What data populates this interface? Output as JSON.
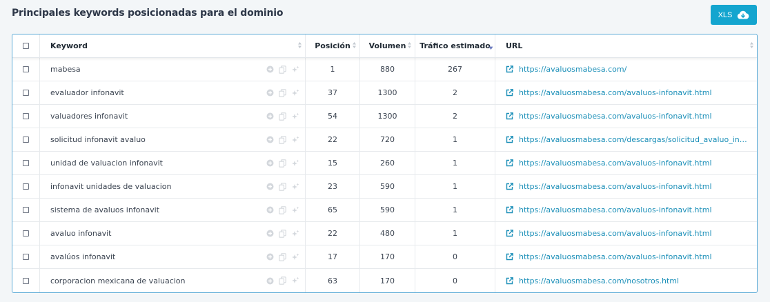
{
  "page_title": "Principales keywords posicionadas para el dominio",
  "export_button": {
    "label": "XLS",
    "icon": "cloud-download-icon"
  },
  "colors": {
    "accent": "#14a5cf",
    "link": "#1b8fb8",
    "table_border": "#5aa9d6"
  },
  "table": {
    "columns": {
      "keyword": "Keyword",
      "position": "Posición",
      "volume": "Volumen",
      "traffic": "Tráfico estimado",
      "url": "URL"
    },
    "sorted_by": "traffic",
    "rows": [
      {
        "keyword": "mabesa",
        "position": "1",
        "volume": "880",
        "traffic": "267",
        "url": "https://avaluosmabesa.com/"
      },
      {
        "keyword": "evaluador infonavit",
        "position": "37",
        "volume": "1300",
        "traffic": "2",
        "url": "https://avaluosmabesa.com/avaluos-infonavit.html"
      },
      {
        "keyword": "valuadores infonavit",
        "position": "54",
        "volume": "1300",
        "traffic": "2",
        "url": "https://avaluosmabesa.com/avaluos-infonavit.html"
      },
      {
        "keyword": "solicitud infonavit avaluo",
        "position": "22",
        "volume": "720",
        "traffic": "1",
        "url": "https://avaluosmabesa.com/descargas/solicitud_avaluo_infona…"
      },
      {
        "keyword": "unidad de valuacion infonavit",
        "position": "15",
        "volume": "260",
        "traffic": "1",
        "url": "https://avaluosmabesa.com/avaluos-infonavit.html"
      },
      {
        "keyword": "infonavit unidades de valuacion",
        "position": "23",
        "volume": "590",
        "traffic": "1",
        "url": "https://avaluosmabesa.com/avaluos-infonavit.html"
      },
      {
        "keyword": "sistema de avaluos infonavit",
        "position": "65",
        "volume": "590",
        "traffic": "1",
        "url": "https://avaluosmabesa.com/avaluos-infonavit.html"
      },
      {
        "keyword": "avaluo infonavit",
        "position": "22",
        "volume": "480",
        "traffic": "1",
        "url": "https://avaluosmabesa.com/avaluos-infonavit.html"
      },
      {
        "keyword": "avalúos infonavit",
        "position": "17",
        "volume": "170",
        "traffic": "0",
        "url": "https://avaluosmabesa.com/avaluos-infonavit.html"
      },
      {
        "keyword": "corporacion mexicana de valuacion",
        "position": "63",
        "volume": "170",
        "traffic": "0",
        "url": "https://avaluosmabesa.com/nosotros.html"
      }
    ]
  }
}
